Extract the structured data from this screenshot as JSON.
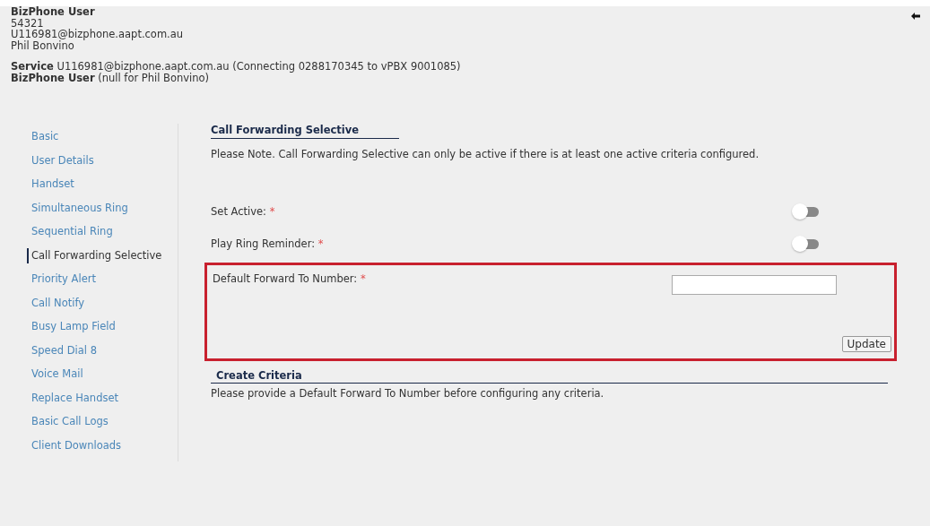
{
  "header": {
    "title": "BizPhone User",
    "lines": [
      "54321",
      "U116981@bizphone.aapt.com.au",
      "Phil Bonvino"
    ]
  },
  "service": {
    "label": "Service",
    "text": "U116981@bizphone.aapt.com.au (Connecting 0288170345 to vPBX 9001085)",
    "user_label": "BizPhone User",
    "user_text": "(null for Phil Bonvino)"
  },
  "sidebar": {
    "items": [
      {
        "label": "Basic",
        "selected": false
      },
      {
        "label": "User Details",
        "selected": false
      },
      {
        "label": "Handset",
        "selected": false
      },
      {
        "label": "Simultaneous Ring",
        "selected": false
      },
      {
        "label": "Sequential Ring",
        "selected": false
      },
      {
        "label": "Call Forwarding Selective",
        "selected": true
      },
      {
        "label": "Priority Alert",
        "selected": false
      },
      {
        "label": "Call Notify",
        "selected": false
      },
      {
        "label": "Busy Lamp Field",
        "selected": false
      },
      {
        "label": "Speed Dial 8",
        "selected": false
      },
      {
        "label": "Voice Mail",
        "selected": false
      },
      {
        "label": "Replace Handset",
        "selected": false
      },
      {
        "label": "Basic Call Logs",
        "selected": false
      },
      {
        "label": "Client Downloads",
        "selected": false
      }
    ]
  },
  "section": {
    "title": "Call Forwarding Selective",
    "note": "Please Note. Call Forwarding Selective can only be active if there is at least one active criteria configured.",
    "toggles": [
      {
        "label": "Set Active:",
        "required_mark": "*",
        "on": false
      },
      {
        "label": "Play Ring Reminder:",
        "required_mark": "*",
        "on": false
      }
    ],
    "forward": {
      "label": "Default Forward To Number:",
      "required_mark": "*",
      "button": "Update"
    }
  },
  "criteria": {
    "title": "Create Criteria",
    "text": "Please provide a Default Forward To Number before configuring any criteria."
  }
}
